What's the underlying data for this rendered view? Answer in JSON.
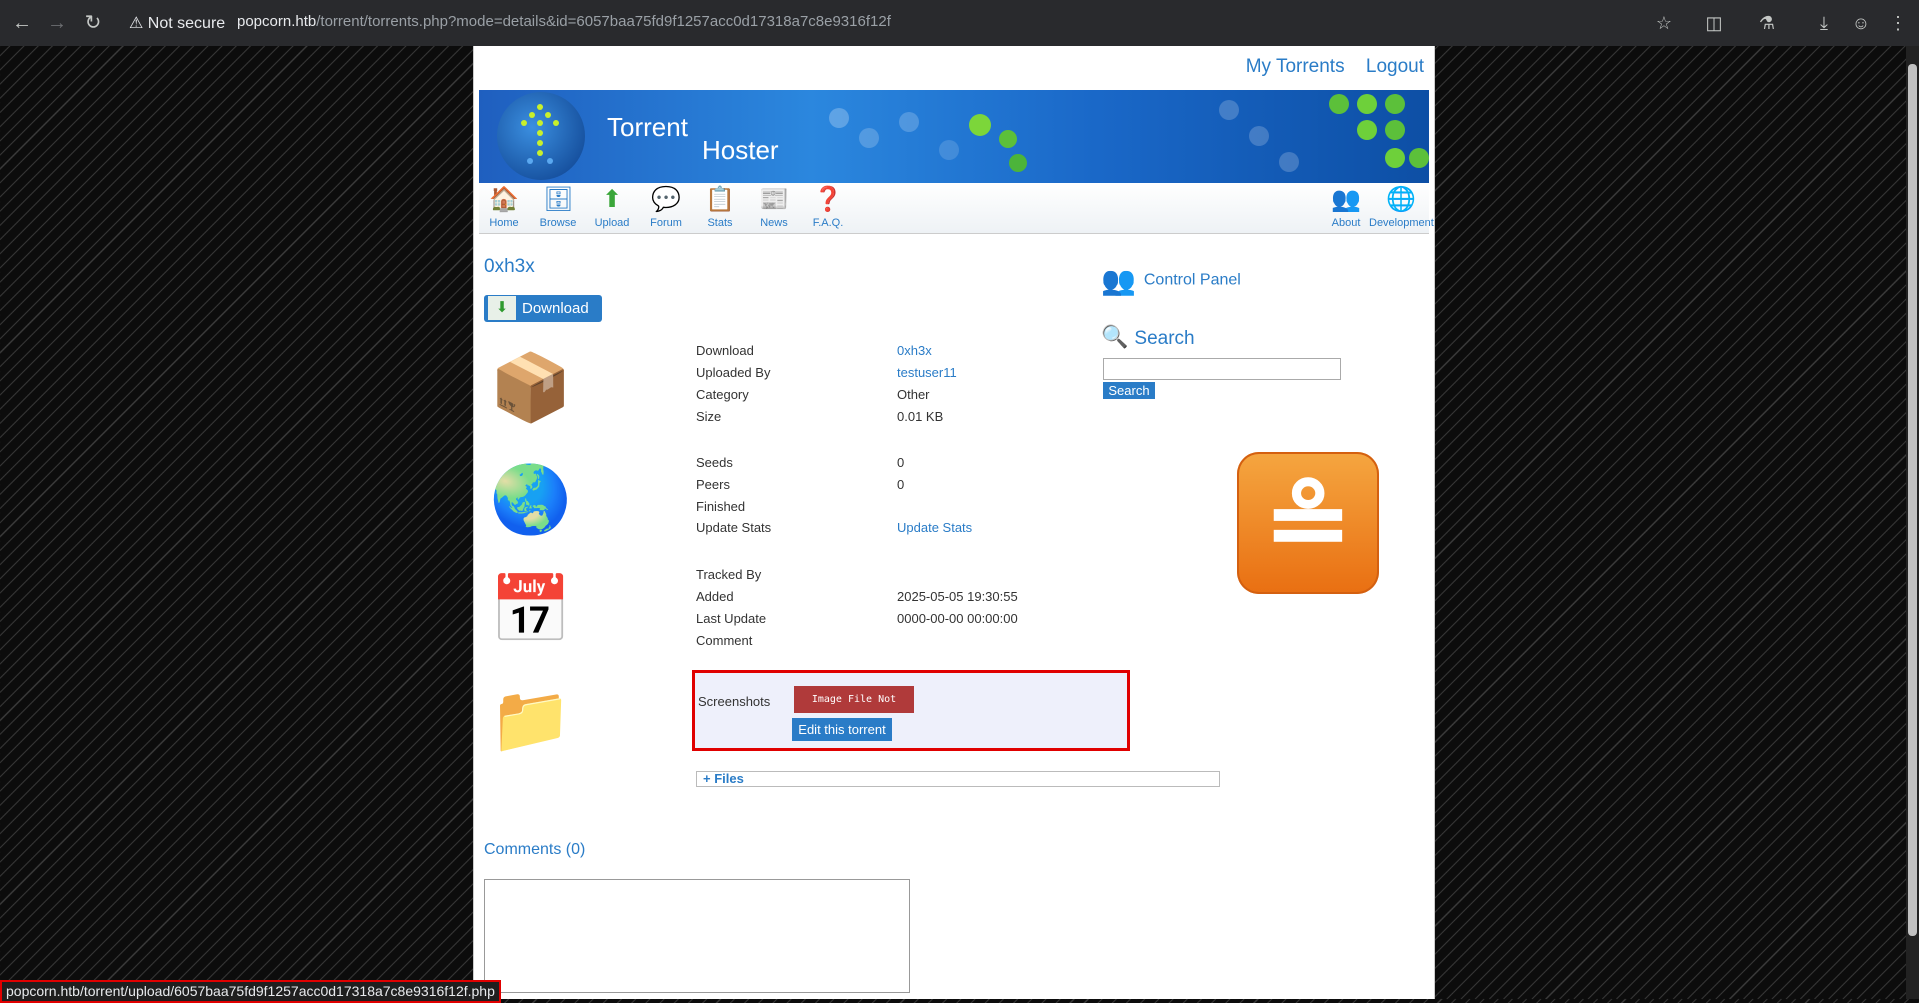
{
  "browser": {
    "security_label": "Not secure",
    "url_host": "popcorn.htb",
    "url_path": "/torrent/torrents.php?mode=details&id=6057baa75fd9f1257acc0d17318a7c8e9316f12f",
    "status_url": "popcorn.htb/torrent/upload/6057baa75fd9f1257acc0d17318a7c8e9316f12f.php"
  },
  "header": {
    "my_torrents": "My Torrents",
    "logout": "Logout",
    "brand_line1": "Torrent",
    "brand_line2": "Hoster"
  },
  "nav": {
    "items": [
      {
        "label": "Home",
        "icon": "home-icon"
      },
      {
        "label": "Browse",
        "icon": "browse-icon"
      },
      {
        "label": "Upload",
        "icon": "upload-icon"
      },
      {
        "label": "Forum",
        "icon": "forum-icon"
      },
      {
        "label": "Stats",
        "icon": "stats-icon"
      },
      {
        "label": "News",
        "icon": "news-icon"
      },
      {
        "label": "F.A.Q.",
        "icon": "faq-icon"
      }
    ],
    "right_items": [
      {
        "label": "About",
        "icon": "about-icon"
      },
      {
        "label": "Development",
        "icon": "development-icon"
      }
    ]
  },
  "torrent": {
    "name": "0xh3x",
    "download_button": "Download",
    "details": [
      {
        "label": "Download",
        "value": "0xh3x"
      },
      {
        "label": "Uploaded By",
        "value": "testuser11"
      },
      {
        "label": "Category",
        "value": "Other"
      },
      {
        "label": "Size",
        "value": "0.01 KB"
      },
      {
        "label": "Seeds",
        "value": "0"
      },
      {
        "label": "Peers",
        "value": "0"
      },
      {
        "label": "Finished",
        "value": ""
      },
      {
        "label": "Update Stats",
        "value": "Update Stats"
      },
      {
        "label": "Tracked By",
        "value": ""
      },
      {
        "label": "Added",
        "value": "2025-05-05 19:30:55"
      },
      {
        "label": "Last Update",
        "value": "0000-00-00 00:00:00"
      },
      {
        "label": "Comment",
        "value": ""
      }
    ],
    "screenshots_label": "Screenshots",
    "screenshot_error": "Image File Not Found!",
    "edit_button": "Edit this torrent",
    "files_toggle": "+ Files",
    "comments_title": "Comments (0)"
  },
  "sidebar": {
    "control_panel": "Control Panel",
    "search_title": "Search",
    "search_button": "Search"
  }
}
